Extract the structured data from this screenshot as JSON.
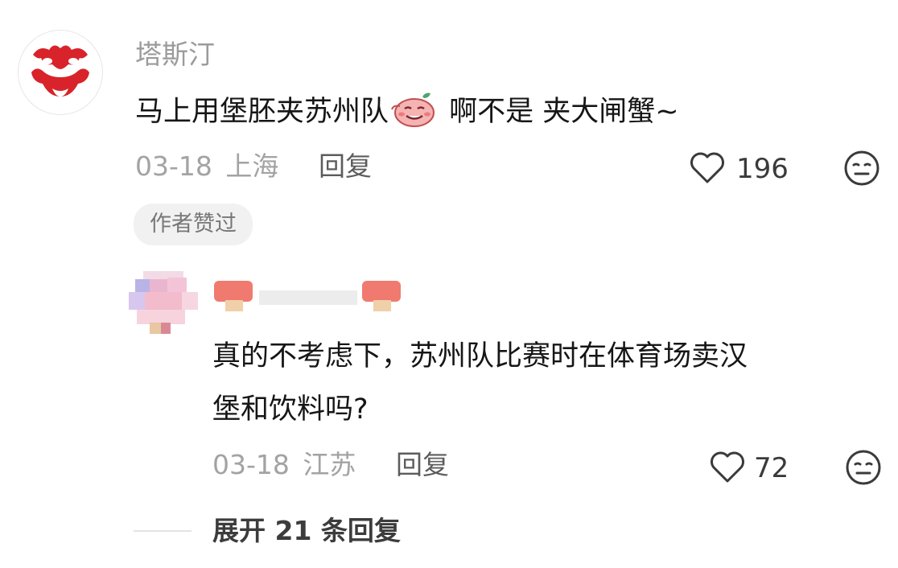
{
  "comment": {
    "username": "塔斯汀",
    "text_before_emoji": "马上用堡胚夹苏州队",
    "emoji": "smiling-pink-face-emoji",
    "text_after_emoji": " 啊不是 夹大闸蟹~",
    "date": "03-18",
    "location": "上海",
    "reply_label": "回复",
    "like_count": "196",
    "author_liked_badge": "作者赞过"
  },
  "reply": {
    "text_line1": "真的不考虑下，苏州队比赛时在体育场卖汉",
    "text_line2": "堡和饮料吗?",
    "date": "03-18",
    "location": "江苏",
    "reply_label": "回复",
    "like_count": "72"
  },
  "expand": {
    "label": "展开 21 条回复"
  },
  "colors": {
    "logo_red": "#d8232a",
    "meta_gray": "#a3a3a3",
    "text_dark": "#161616"
  }
}
